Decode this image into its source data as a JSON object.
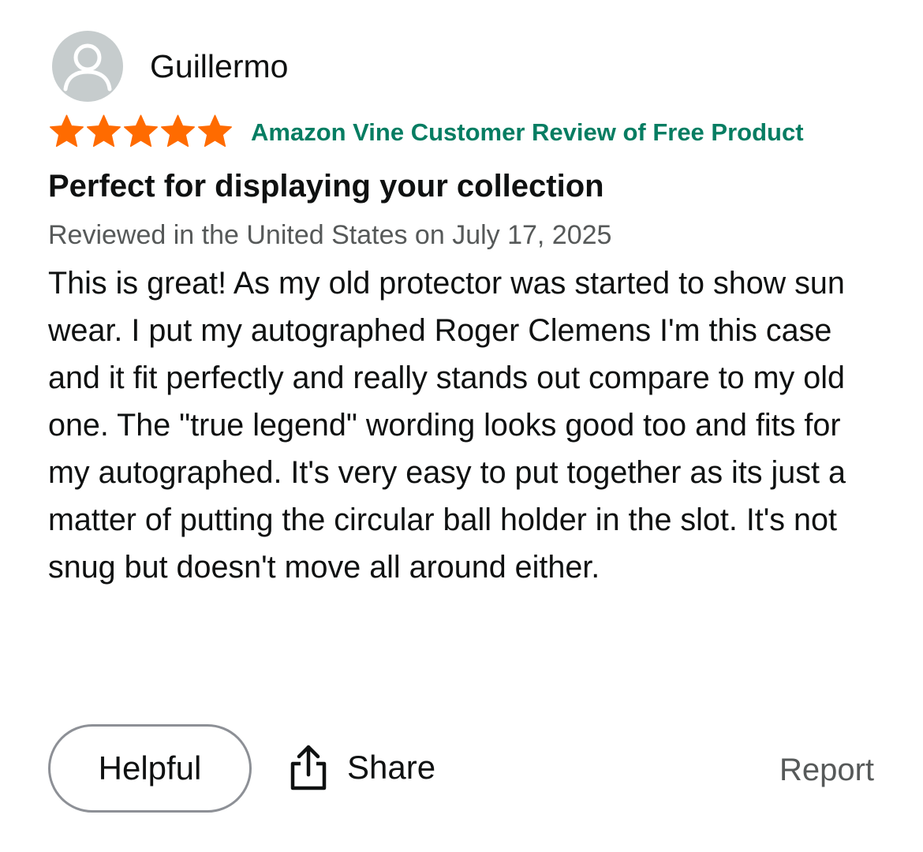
{
  "reviewer": {
    "name": "Guillermo",
    "avatar_icon": "person-silhouette-icon"
  },
  "rating": {
    "stars": 5,
    "max": 5,
    "star_color": "#ff6b00"
  },
  "badge": {
    "label": "Amazon Vine Customer Review of Free Product",
    "color": "#067d62"
  },
  "review": {
    "title": "Perfect for displaying your collection",
    "meta": "Reviewed in the United States on July 17, 2025",
    "body": "This is great! As my old protector was started to show sun wear. I put my autographed Roger Clemens I'm this case and it fit perfectly and really stands out compare to my old one. The \"true legend\" wording looks good too and fits for my autographed. It's very easy to put together as its just a matter of putting the circular ball holder in the slot. It's not snug but doesn't move all around either."
  },
  "actions": {
    "helpful_label": "Helpful",
    "share_label": "Share",
    "share_icon": "share-icon",
    "report_label": "Report"
  }
}
